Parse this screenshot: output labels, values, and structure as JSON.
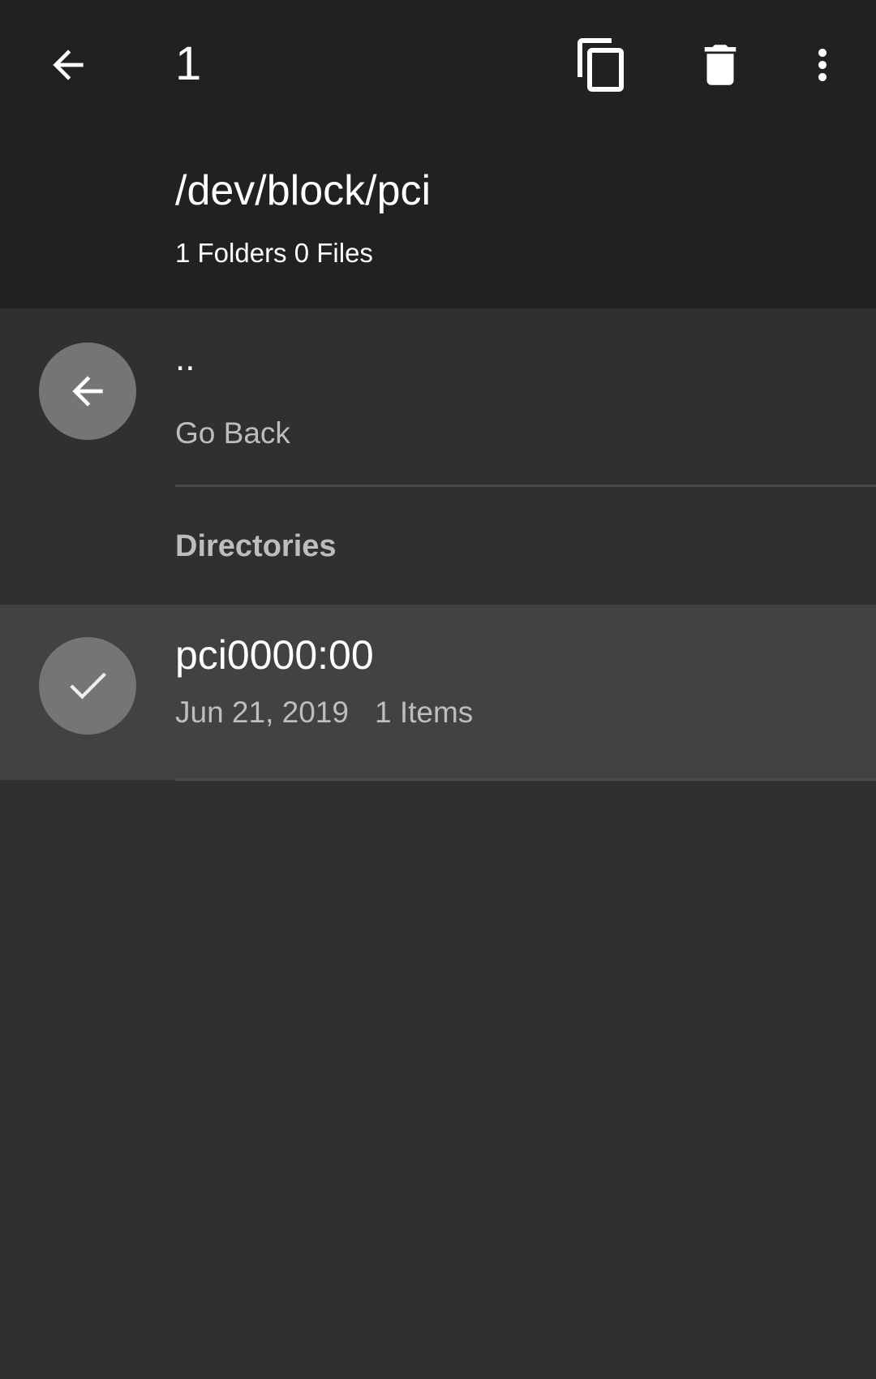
{
  "toolbar": {
    "selection_count": "1",
    "icons": {
      "back": "arrow-back-icon",
      "copy": "copy-icon",
      "delete": "delete-icon",
      "more": "more-vert-icon"
    }
  },
  "header": {
    "path": "/dev/block/pci",
    "summary": "1 Folders 0 Files"
  },
  "list": {
    "go_back": {
      "title": "..",
      "subtitle": "Go Back",
      "icon": "arrow-back-icon"
    },
    "section_header": "Directories",
    "items": [
      {
        "name": "pci0000:00",
        "date": "Jun 21, 2019",
        "count": "1 Items",
        "selected": true,
        "icon": "check-icon"
      }
    ]
  },
  "colors": {
    "app_bar": "#212121",
    "background": "#303030",
    "selected_row": "#424242",
    "avatar": "#757575",
    "secondary_text": "#bdbdbd"
  }
}
